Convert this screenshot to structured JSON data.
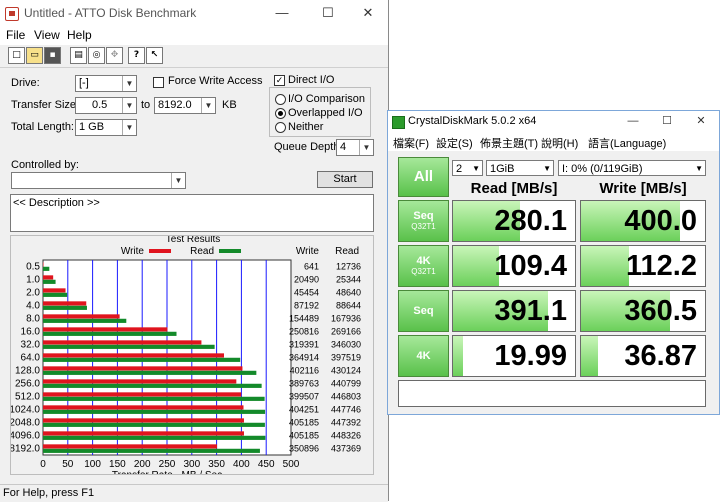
{
  "atto": {
    "title": "Untitled - ATTO Disk Benchmark",
    "window_buttons": [
      "—",
      "☐",
      "✕"
    ],
    "menu": [
      "File",
      "View",
      "Help"
    ],
    "toolbar_icons": [
      "new-icon",
      "open-icon",
      "save-icon",
      "print-icon",
      "print-preview-icon",
      "move-icon",
      "about-icon",
      "help-pointer-icon"
    ],
    "drive_label": "Drive:",
    "drive_value": "[-]",
    "transfer_size_label": "Transfer Size:",
    "transfer_from": "0.5",
    "to_label": "to",
    "transfer_to": "8192.0",
    "kb_label": "KB",
    "total_length_label": "Total Length:",
    "total_length_value": "1 GB",
    "force_write_access": "Force Write Access",
    "direct_io": "Direct I/O",
    "io_comparison": "I/O Comparison",
    "overlapped_io": "Overlapped I/O",
    "neither": "Neither",
    "queue_depth_label": "Queue Depth:",
    "queue_depth_value": "4",
    "controlled_by_label": "Controlled by:",
    "controlled_by_value": "",
    "start_label": "Start",
    "description": "<< Description >>",
    "status": "For Help, press F1"
  },
  "chart_data": {
    "type": "bar",
    "title": "Test Results",
    "legend": [
      "Write",
      "Read"
    ],
    "legend_placement": "top",
    "colors": {
      "write": "#e0141e",
      "read": "#138a2a"
    },
    "categories": [
      "0.5",
      "1.0",
      "2.0",
      "4.0",
      "8.0",
      "16.0",
      "32.0",
      "64.0",
      "128.0",
      "256.0",
      "512.0",
      "1024.0",
      "2048.0",
      "4096.0",
      "8192.0"
    ],
    "series": [
      {
        "name": "Write",
        "values": [
          641,
          20490,
          45454,
          87192,
          154489,
          250816,
          319391,
          364914,
          402116,
          389763,
          399507,
          404251,
          405185,
          405185,
          350896
        ]
      },
      {
        "name": "Read",
        "values": [
          12736,
          25344,
          48640,
          88644,
          167936,
          269166,
          346030,
          397519,
          430124,
          440799,
          446803,
          447746,
          447392,
          448326,
          437369
        ]
      }
    ],
    "col_headers": [
      "Write",
      "Read"
    ],
    "xlabel": "Transfer Rate - MB / Sec",
    "xticks": [
      0,
      50,
      100,
      150,
      200,
      250,
      300,
      350,
      400,
      450,
      500
    ],
    "xlim": [
      0,
      500
    ],
    "grid": true
  },
  "cdm": {
    "title": "CrystalDiskMark 5.0.2 x64",
    "window_buttons": [
      "—",
      "☐",
      "✕"
    ],
    "menu": [
      "檔案(F)",
      "設定(S)",
      "佈景主題(T)",
      "說明(H)",
      "語言(Language)"
    ],
    "all_label": "All",
    "count": "2",
    "size": "1GiB",
    "drive": "I: 0% (0/119GiB)",
    "read_header": "Read [MB/s]",
    "write_header": "Write [MB/s]",
    "rows": [
      {
        "main": "Seq",
        "sub": "Q32T1",
        "read": "280.1",
        "write": "400.0",
        "read_fill": 0.55,
        "write_fill": 0.8
      },
      {
        "main": "4K",
        "sub": "Q32T1",
        "read": "109.4",
        "write": "112.2",
        "read_fill": 0.38,
        "write_fill": 0.39
      },
      {
        "main": "Seq",
        "sub": "",
        "read": "391.1",
        "write": "360.5",
        "read_fill": 0.78,
        "write_fill": 0.72
      },
      {
        "main": "4K",
        "sub": "",
        "read": "19.99",
        "write": "36.87",
        "read_fill": 0.08,
        "write_fill": 0.14
      }
    ],
    "comment": ""
  }
}
